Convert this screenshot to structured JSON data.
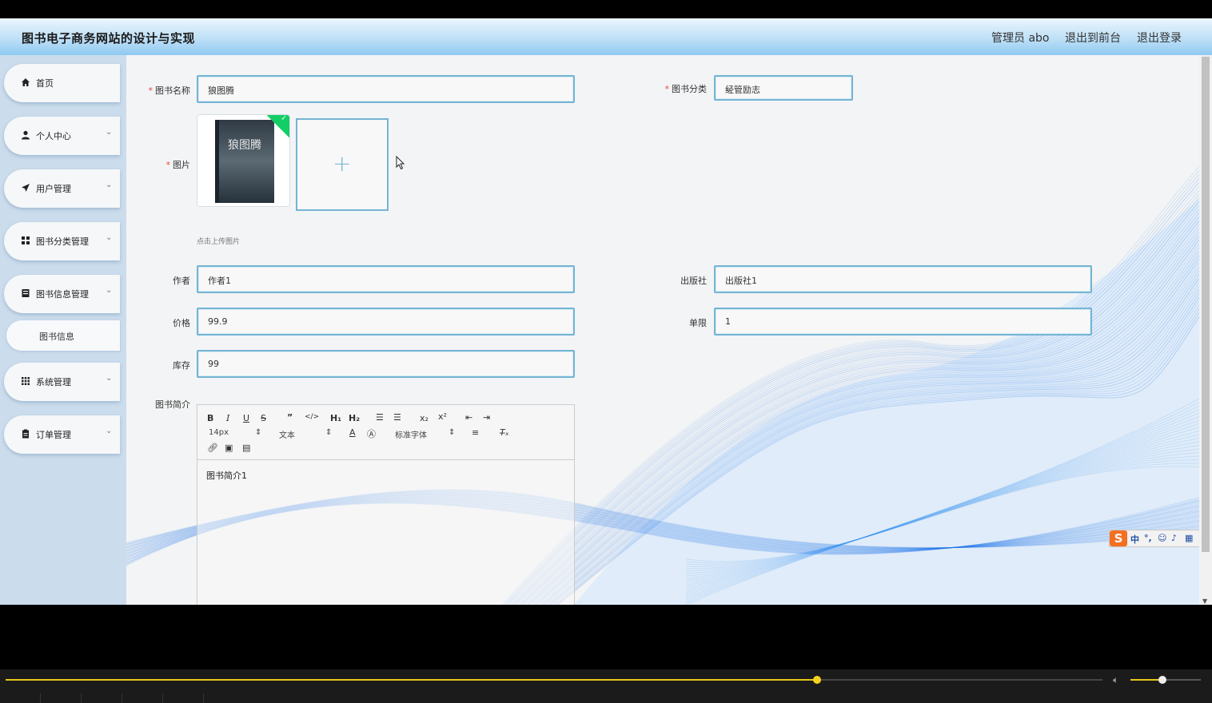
{
  "header": {
    "title": "图书电子商务网站的设计与实现",
    "user_label": "管理员 abo",
    "front_link": "退出到前台",
    "logout_link": "退出登录"
  },
  "sidebar": {
    "items": [
      {
        "label": "首页",
        "icon": "home-icon"
      },
      {
        "label": "个人中心",
        "icon": "user-icon"
      },
      {
        "label": "用户管理",
        "icon": "send-icon"
      },
      {
        "label": "图书分类管理",
        "icon": "grid-icon"
      },
      {
        "label": "图书信息管理",
        "icon": "book-icon"
      },
      {
        "label": "系统管理",
        "icon": "apps-icon"
      },
      {
        "label": "订单管理",
        "icon": "clipboard-icon"
      }
    ],
    "sub_item": "图书信息"
  },
  "form": {
    "name_label": "图书名称",
    "name_value": "狼图腾",
    "category_label": "图书分类",
    "category_value": "经管励志",
    "image_label": "图片",
    "upload_tip": "点击上传图片",
    "cover_title": "狼图腾",
    "author_label": "作者",
    "author_value": "作者1",
    "publisher_label": "出版社",
    "publisher_value": "出版社1",
    "price_label": "价格",
    "price_value": "99.9",
    "limit_label": "单限",
    "limit_value": "1",
    "stock_label": "库存",
    "stock_value": "99",
    "intro_label": "图书简介"
  },
  "editor": {
    "font_size": "14px",
    "block_format": "文本",
    "font_family": "标准字体",
    "content": "图书简介1"
  },
  "player": {
    "progress": 0.74,
    "volume": 0.45
  },
  "colors": {
    "accent": "#74b4d4",
    "header_top": "#eaf5fd",
    "header_bottom": "#8ec9f1",
    "sidebar_bg": "#cbdcec",
    "wave_blue": "#1a73e8",
    "seek_yellow": "#e8c81a"
  }
}
